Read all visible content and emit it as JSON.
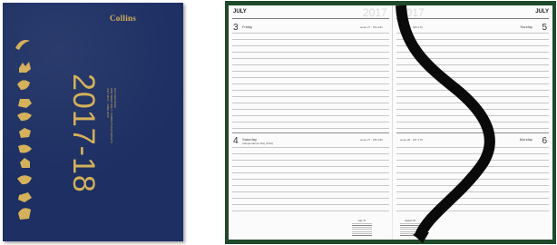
{
  "cover": {
    "brand": "Collins",
    "year": "2017-18",
    "small_lines": [
      "DAY-PER-PAGE",
      "ONE WEEK ONLY • SUNDAYS/SATURDAYS",
      "JULY 2017 - JUNE 2018"
    ],
    "colors": {
      "cover": "#1d2f63",
      "gold": "#d4b15a"
    }
  },
  "diary": {
    "left_page": {
      "month": "JULY",
      "year": "2017",
      "top_day": {
        "number": "3",
        "name": "Friday",
        "week": "week 27 · 184-181"
      },
      "bottom_day": {
        "number": "4",
        "name": "Saturday",
        "note": "Independence Day (USA)",
        "week": "week 27 · 185-180"
      },
      "mini_calendar": {
        "title": "July '17"
      }
    },
    "right_page": {
      "month": "JULY",
      "year": "2017",
      "top_day": {
        "number": "5",
        "name": "Sunday",
        "week": "week 27 · 186-179"
      },
      "bottom_day": {
        "number": "6",
        "name": "Monday",
        "week": "week 28 · 187-178"
      },
      "mini_calendar": {
        "title": "August '18"
      }
    },
    "colors": {
      "board": "#1e4a2a",
      "bookmark": "#0a0a0a",
      "page": "#fbfbfb"
    }
  }
}
